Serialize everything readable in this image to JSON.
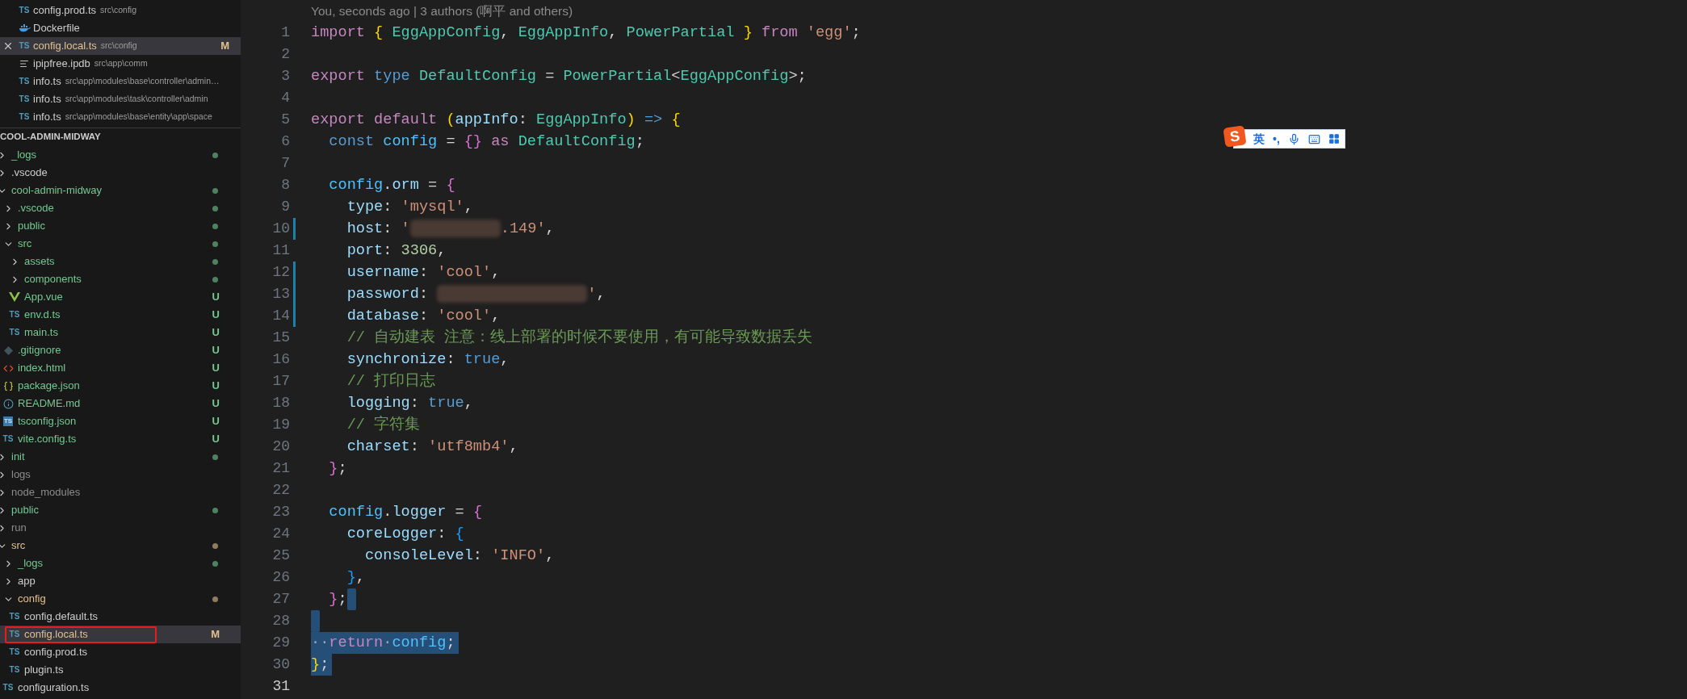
{
  "open_editors": [
    {
      "name": "config.prod.ts",
      "description": "src\\config",
      "kind": "ts",
      "icon_text": "TS",
      "color": "#cccccc",
      "selected": false
    },
    {
      "name": "Dockerfile",
      "kind": "docker",
      "color": "#cccccc",
      "selected": false
    },
    {
      "name": "config.local.ts",
      "description": "src\\config",
      "kind": "ts",
      "icon_text": "TS",
      "color": "#e2c08d",
      "badge": "M",
      "selected": true
    },
    {
      "name": "ipipfree.ipdb",
      "description": "src\\app\\comm",
      "kind": "lines",
      "color": "#cccccc",
      "selected": false
    },
    {
      "name": "info.ts",
      "description": "src\\app\\modules\\base\\controller\\admin…",
      "kind": "ts",
      "icon_text": "TS",
      "color": "#cccccc",
      "selected": false
    },
    {
      "name": "info.ts",
      "description": "src\\app\\modules\\task\\controller\\admin",
      "kind": "ts",
      "icon_text": "TS",
      "color": "#cccccc",
      "selected": false
    },
    {
      "name": "info.ts",
      "description": "src\\app\\modules\\base\\entity\\app\\space",
      "kind": "ts",
      "icon_text": "TS",
      "color": "#cccccc",
      "selected": false
    }
  ],
  "explorer": {
    "title": "COOL-ADMIN-MIDWAY",
    "items": [
      {
        "name": "_logs",
        "kind": "folder",
        "expanded": false,
        "color": "#73c991",
        "dot": true,
        "selected": false
      },
      {
        "name": ".vscode",
        "kind": "folder",
        "expanded": false,
        "color": "#cccccc",
        "dot": false,
        "selected": false
      },
      {
        "name": "cool-admin-midway",
        "kind": "folder",
        "expanded": true,
        "color": "#73c991",
        "dot": true,
        "selected": false,
        "children": [
          {
            "name": ".vscode",
            "kind": "folder",
            "expanded": false,
            "color": "#73c991",
            "dot": true,
            "selected": false
          },
          {
            "name": "public",
            "kind": "folder",
            "expanded": false,
            "color": "#73c991",
            "dot": true,
            "selected": false
          },
          {
            "name": "src",
            "kind": "folder",
            "expanded": true,
            "color": "#73c991",
            "dot": true,
            "selected": false,
            "children": [
              {
                "name": "assets",
                "kind": "folder",
                "expanded": false,
                "color": "#73c991",
                "dot": true,
                "selected": false
              },
              {
                "name": "components",
                "kind": "folder",
                "expanded": false,
                "color": "#73c991",
                "dot": true,
                "selected": false
              },
              {
                "name": "App.vue",
                "kind": "vue",
                "color": "#73c991",
                "badge": "U",
                "selected": false
              },
              {
                "name": "env.d.ts",
                "kind": "ts",
                "icon_text": "TS",
                "color": "#73c991",
                "badge": "U",
                "selected": false
              },
              {
                "name": "main.ts",
                "kind": "ts",
                "icon_text": "TS",
                "color": "#73c991",
                "badge": "U",
                "selected": false
              }
            ]
          },
          {
            "name": ".gitignore",
            "kind": "git",
            "color": "#73c991",
            "badge": "U",
            "selected": false
          },
          {
            "name": "index.html",
            "kind": "html",
            "color": "#73c991",
            "badge": "U",
            "selected": false
          },
          {
            "name": "package.json",
            "kind": "json",
            "color": "#73c991",
            "badge": "U",
            "selected": false
          },
          {
            "name": "README.md",
            "kind": "info",
            "color": "#73c991",
            "badge": "U",
            "selected": false
          },
          {
            "name": "tsconfig.json",
            "kind": "tsconfig",
            "icon_text": "TS",
            "color": "#73c991",
            "badge": "U",
            "selected": false
          },
          {
            "name": "vite.config.ts",
            "kind": "ts",
            "icon_text": "TS",
            "color": "#73c991",
            "badge": "U",
            "selected": false
          }
        ]
      },
      {
        "name": "init",
        "kind": "folder",
        "expanded": false,
        "color": "#73c991",
        "dot": true,
        "selected": false
      },
      {
        "name": "logs",
        "kind": "folder",
        "expanded": false,
        "color": "#8c8c8c",
        "dot": false,
        "selected": false
      },
      {
        "name": "node_modules",
        "kind": "folder",
        "expanded": false,
        "color": "#8c8c8c",
        "dot": false,
        "selected": false
      },
      {
        "name": "public",
        "kind": "folder",
        "expanded": false,
        "color": "#73c991",
        "dot": true,
        "selected": false
      },
      {
        "name": "run",
        "kind": "folder",
        "expanded": false,
        "color": "#8c8c8c",
        "dot": false,
        "selected": false
      },
      {
        "name": "src",
        "kind": "folder",
        "expanded": true,
        "color": "#e2c08d",
        "dot": true,
        "selected": false,
        "children": [
          {
            "name": "_logs",
            "kind": "folder",
            "expanded": false,
            "color": "#73c991",
            "dot": true,
            "selected": false
          },
          {
            "name": "app",
            "kind": "folder",
            "expanded": false,
            "color": "#cccccc",
            "dot": false,
            "selected": false
          },
          {
            "name": "config",
            "kind": "folder",
            "expanded": true,
            "color": "#e2c08d",
            "dot": true,
            "selected": false,
            "children": [
              {
                "name": "config.default.ts",
                "kind": "ts",
                "icon_text": "TS",
                "color": "#cccccc",
                "selected": false,
                "highlighted": false
              },
              {
                "name": "config.local.ts",
                "kind": "ts",
                "icon_text": "TS",
                "color": "#e2c08d",
                "badge": "M",
                "selected": true,
                "highlighted": true
              },
              {
                "name": "config.prod.ts",
                "kind": "ts",
                "icon_text": "TS",
                "color": "#cccccc",
                "selected": false,
                "highlighted": false
              },
              {
                "name": "plugin.ts",
                "kind": "ts",
                "icon_text": "TS",
                "color": "#cccccc",
                "selected": false,
                "highlighted": false
              }
            ]
          },
          {
            "name": "configuration.ts",
            "kind": "ts",
            "icon_text": "TS",
            "color": "#cccccc",
            "selected": false
          }
        ]
      }
    ]
  },
  "editor": {
    "blame": "You, seconds ago | 3 authors (啊平 and others)",
    "lines": [
      {
        "number": "1",
        "changed": false,
        "selected": false,
        "current": false,
        "tokens": [
          {
            "kind": "kw",
            "text": "import "
          },
          {
            "kind": "b1",
            "text": "{ "
          },
          {
            "kind": "type",
            "text": "EggAppConfig"
          },
          {
            "kind": "p",
            "text": ", "
          },
          {
            "kind": "type",
            "text": "EggAppInfo"
          },
          {
            "kind": "p",
            "text": ", "
          },
          {
            "kind": "type",
            "text": "PowerPartial "
          },
          {
            "kind": "b1",
            "text": "} "
          },
          {
            "kind": "kw",
            "text": "from "
          },
          {
            "kind": "str",
            "text": "'egg'"
          },
          {
            "kind": "p",
            "text": ";"
          }
        ]
      },
      {
        "number": "2",
        "changed": false,
        "selected": false,
        "current": false
      },
      {
        "number": "3",
        "changed": false,
        "selected": false,
        "current": false,
        "tokens": [
          {
            "kind": "kw",
            "text": "export "
          },
          {
            "kind": "st",
            "text": "type "
          },
          {
            "kind": "type",
            "text": "DefaultConfig"
          },
          {
            "kind": "p",
            "text": " = "
          },
          {
            "kind": "type",
            "text": "PowerPartial"
          },
          {
            "kind": "p",
            "text": "<"
          },
          {
            "kind": "type",
            "text": "EggAppConfig"
          },
          {
            "kind": "p",
            "text": ">;"
          }
        ]
      },
      {
        "number": "4",
        "changed": false,
        "selected": false,
        "current": false
      },
      {
        "number": "5",
        "changed": false,
        "selected": false,
        "current": false,
        "tokens": [
          {
            "kind": "kw",
            "text": "export default "
          },
          {
            "kind": "b1",
            "text": "("
          },
          {
            "kind": "prop",
            "text": "appInfo"
          },
          {
            "kind": "p",
            "text": ": "
          },
          {
            "kind": "type",
            "text": "EggAppInfo"
          },
          {
            "kind": "b1",
            "text": ") "
          },
          {
            "kind": "st",
            "text": "=> "
          },
          {
            "kind": "b1",
            "text": "{"
          }
        ]
      },
      {
        "number": "6",
        "changed": false,
        "selected": false,
        "current": false,
        "tokens": [
          {
            "kind": "st",
            "text": "  const "
          },
          {
            "kind": "const",
            "text": "config"
          },
          {
            "kind": "p",
            "text": " = "
          },
          {
            "kind": "b2",
            "text": "{} "
          },
          {
            "kind": "kw",
            "text": "as "
          },
          {
            "kind": "type",
            "text": "DefaultConfig"
          },
          {
            "kind": "p",
            "text": ";"
          }
        ]
      },
      {
        "number": "7",
        "changed": false,
        "selected": false,
        "current": false
      },
      {
        "number": "8",
        "changed": false,
        "selected": false,
        "current": false,
        "tokens": [
          {
            "kind": "const",
            "text": "  config"
          },
          {
            "kind": "p",
            "text": "."
          },
          {
            "kind": "prop",
            "text": "orm"
          },
          {
            "kind": "p",
            "text": " = "
          },
          {
            "kind": "b2",
            "text": "{"
          }
        ]
      },
      {
        "number": "9",
        "changed": false,
        "selected": false,
        "current": false,
        "tokens": [
          {
            "kind": "prop",
            "text": "    type"
          },
          {
            "kind": "p",
            "text": ": "
          },
          {
            "kind": "str",
            "text": "'mysql'"
          },
          {
            "kind": "p",
            "text": ","
          }
        ]
      },
      {
        "number": "10",
        "changed": true,
        "selected": false,
        "current": false,
        "tokens": [
          {
            "kind": "prop",
            "text": "    host"
          },
          {
            "kind": "p",
            "text": ": "
          },
          {
            "kind": "str",
            "text": "'"
          },
          {
            "kind": "redacted_short"
          },
          {
            "kind": "str",
            "text": ".149'"
          },
          {
            "kind": "p",
            "text": ","
          }
        ]
      },
      {
        "number": "11",
        "changed": false,
        "selected": false,
        "current": false,
        "tokens": [
          {
            "kind": "prop",
            "text": "    port"
          },
          {
            "kind": "p",
            "text": ": "
          },
          {
            "kind": "num",
            "text": "3306"
          },
          {
            "kind": "p",
            "text": ","
          }
        ]
      },
      {
        "number": "12",
        "changed": true,
        "selected": false,
        "current": false,
        "tokens": [
          {
            "kind": "prop",
            "text": "    username"
          },
          {
            "kind": "p",
            "text": ": "
          },
          {
            "kind": "str",
            "text": "'cool'"
          },
          {
            "kind": "p",
            "text": ","
          }
        ]
      },
      {
        "number": "13",
        "changed": true,
        "selected": false,
        "current": false,
        "tokens": [
          {
            "kind": "prop",
            "text": "    password"
          },
          {
            "kind": "p",
            "text": ": "
          },
          {
            "kind": "redacted_long"
          },
          {
            "kind": "str",
            "text": "'"
          },
          {
            "kind": "p",
            "text": ","
          }
        ]
      },
      {
        "number": "14",
        "changed": true,
        "selected": false,
        "current": false,
        "tokens": [
          {
            "kind": "prop",
            "text": "    database"
          },
          {
            "kind": "p",
            "text": ": "
          },
          {
            "kind": "str",
            "text": "'cool'"
          },
          {
            "kind": "p",
            "text": ","
          }
        ]
      },
      {
        "number": "15",
        "changed": false,
        "selected": false,
        "current": false,
        "tokens": [
          {
            "kind": "com",
            "text": "    // 自动建表 注意：线上部署的时候不要使用，有可能导致数据丢失"
          }
        ]
      },
      {
        "number": "16",
        "changed": false,
        "selected": false,
        "current": false,
        "tokens": [
          {
            "kind": "prop",
            "text": "    synchronize"
          },
          {
            "kind": "p",
            "text": ": "
          },
          {
            "kind": "st",
            "text": "true"
          },
          {
            "kind": "p",
            "text": ","
          }
        ]
      },
      {
        "number": "17",
        "changed": false,
        "selected": false,
        "current": false,
        "tokens": [
          {
            "kind": "com",
            "text": "    // 打印日志"
          }
        ]
      },
      {
        "number": "18",
        "changed": false,
        "selected": false,
        "current": false,
        "tokens": [
          {
            "kind": "prop",
            "text": "    logging"
          },
          {
            "kind": "p",
            "text": ": "
          },
          {
            "kind": "st",
            "text": "true"
          },
          {
            "kind": "p",
            "text": ","
          }
        ]
      },
      {
        "number": "19",
        "changed": false,
        "selected": false,
        "current": false,
        "tokens": [
          {
            "kind": "com",
            "text": "    // 字符集"
          }
        ]
      },
      {
        "number": "20",
        "changed": false,
        "selected": false,
        "current": false,
        "tokens": [
          {
            "kind": "prop",
            "text": "    charset"
          },
          {
            "kind": "p",
            "text": ": "
          },
          {
            "kind": "str",
            "text": "'utf8mb4'"
          },
          {
            "kind": "p",
            "text": ","
          }
        ]
      },
      {
        "number": "21",
        "changed": false,
        "selected": false,
        "current": false,
        "tokens": [
          {
            "kind": "b2",
            "text": "  }"
          },
          {
            "kind": "p",
            "text": ";"
          }
        ]
      },
      {
        "number": "22",
        "changed": false,
        "selected": false,
        "current": false
      },
      {
        "number": "23",
        "changed": false,
        "selected": false,
        "current": false,
        "tokens": [
          {
            "kind": "const",
            "text": "  config"
          },
          {
            "kind": "p",
            "text": "."
          },
          {
            "kind": "prop",
            "text": "logger"
          },
          {
            "kind": "p",
            "text": " = "
          },
          {
            "kind": "b2",
            "text": "{"
          }
        ]
      },
      {
        "number": "24",
        "changed": false,
        "selected": false,
        "current": false,
        "tokens": [
          {
            "kind": "prop",
            "text": "    coreLogger"
          },
          {
            "kind": "p",
            "text": ": "
          },
          {
            "kind": "b3",
            "text": "{"
          }
        ]
      },
      {
        "number": "25",
        "changed": false,
        "selected": false,
        "current": false,
        "tokens": [
          {
            "kind": "prop",
            "text": "      consoleLevel"
          },
          {
            "kind": "p",
            "text": ": "
          },
          {
            "kind": "str",
            "text": "'INFO'"
          },
          {
            "kind": "p",
            "text": ","
          }
        ]
      },
      {
        "number": "26",
        "changed": false,
        "selected": false,
        "current": false,
        "tokens": [
          {
            "kind": "b3",
            "text": "    }"
          },
          {
            "kind": "p",
            "text": ","
          }
        ]
      },
      {
        "number": "27",
        "changed": false,
        "selected": true,
        "current": false,
        "tokens": [
          {
            "kind": "b2",
            "text": "  }"
          },
          {
            "kind": "p",
            "text": ";"
          }
        ]
      },
      {
        "number": "28",
        "changed": false,
        "selected": true,
        "current": false
      },
      {
        "number": "29",
        "changed": false,
        "selected": true,
        "current": false,
        "tokens": [
          {
            "kind": "ws",
            "text": "··"
          },
          {
            "kind": "kw",
            "text": "return"
          },
          {
            "kind": "ws",
            "text": "·"
          },
          {
            "kind": "const",
            "text": "config"
          },
          {
            "kind": "p",
            "text": ";"
          }
        ]
      },
      {
        "number": "30",
        "changed": false,
        "selected": true,
        "current": false,
        "tokens": [
          {
            "kind": "b1",
            "text": "}"
          },
          {
            "kind": "p",
            "text": ";"
          }
        ]
      },
      {
        "number": "31",
        "changed": false,
        "selected": false,
        "current": true
      }
    ]
  },
  "ime_toolbar": {
    "logo": "S",
    "language": "英",
    "punctuation": "•,"
  }
}
